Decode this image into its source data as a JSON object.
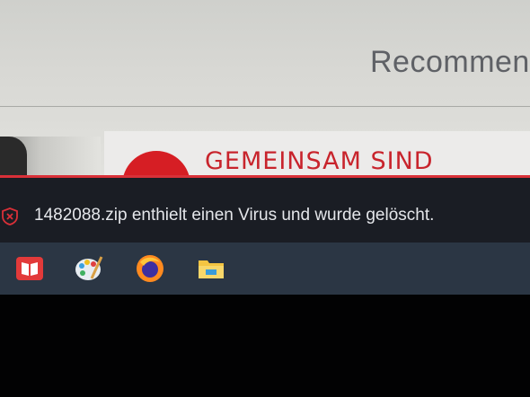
{
  "webpage": {
    "section_heading": "Recommen",
    "banner_text": "GEMEINSAM SIND"
  },
  "notification": {
    "icon": "shield-warning-icon",
    "message": "1482088.zip enthielt einen Virus und wurde gelöscht.",
    "accent_color": "#d93038"
  },
  "taskbar": {
    "apps": [
      {
        "icon": "book-app-icon"
      },
      {
        "icon": "paint-palette-icon"
      },
      {
        "icon": "firefox-icon"
      },
      {
        "icon": "file-explorer-icon"
      }
    ]
  }
}
